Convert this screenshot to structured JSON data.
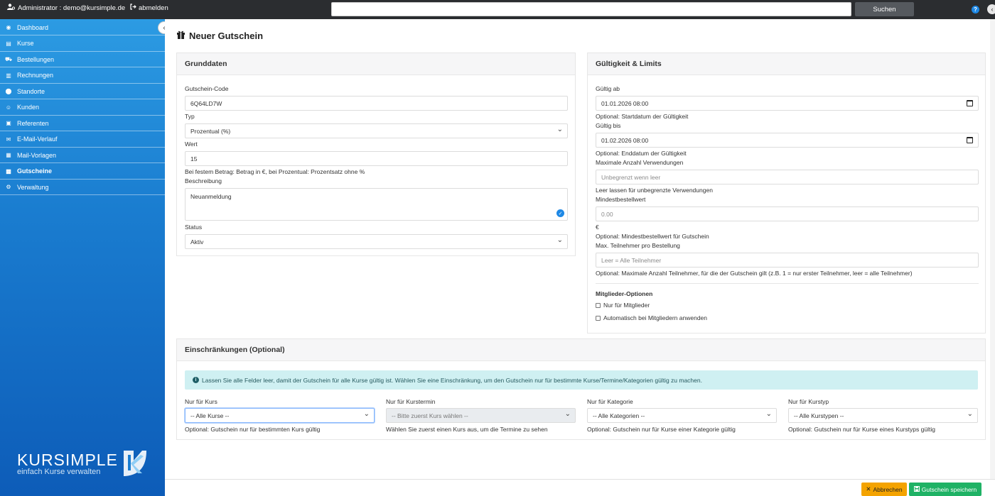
{
  "topbar": {
    "user_label": "Administrator : demo@kursimple.de",
    "logout_label": "abmelden",
    "search_value": "",
    "search_button": "Suchen",
    "help_glyph": "?"
  },
  "sidebar": {
    "items": [
      {
        "label": "Dashboard",
        "icon": "dashboard-icon",
        "glyph": "◉"
      },
      {
        "label": "Kurse",
        "icon": "book-icon",
        "glyph": "▤"
      },
      {
        "label": "Bestellungen",
        "icon": "cart-icon",
        "glyph": "⛟"
      },
      {
        "label": "Rechnungen",
        "icon": "invoice-icon",
        "glyph": "▥"
      },
      {
        "label": "Standorte",
        "icon": "map-marker-icon",
        "glyph": "⬤"
      },
      {
        "label": "Kunden",
        "icon": "users-icon",
        "glyph": "☺"
      },
      {
        "label": "Referenten",
        "icon": "id-card-icon",
        "glyph": "▣"
      },
      {
        "label": "E-Mail-Verlauf",
        "icon": "envelope-icon",
        "glyph": "✉"
      },
      {
        "label": "Mail-Vorlagen",
        "icon": "file-icon",
        "glyph": "▦"
      },
      {
        "label": "Gutscheine",
        "icon": "gift-icon",
        "glyph": "▩"
      },
      {
        "label": "Verwaltung",
        "icon": "gear-icon",
        "glyph": "⚙"
      }
    ],
    "active_index": 9,
    "brand_name": "KURSIMPLE",
    "brand_tagline": "einfach Kurse verwalten"
  },
  "page": {
    "title": "Neuer Gutschein"
  },
  "grunddaten": {
    "title": "Grunddaten",
    "code_label": "Gutschein-Code",
    "code_value": "6Q64LD7W",
    "type_label": "Typ",
    "type_value": "Prozentual (%)",
    "value_label": "Wert",
    "value_value": "15",
    "value_help": "Bei festem Betrag: Betrag in €, bei Prozentual: Prozentsatz ohne %",
    "desc_label": "Beschreibung",
    "desc_value": "Neuanmeldung",
    "status_label": "Status",
    "status_value": "Aktiv"
  },
  "gueltigkeit": {
    "title": "Gültigkeit & Limits",
    "from_label": "Gültig ab",
    "from_value": "01.01.2026 08:00",
    "from_help": "Optional: Startdatum der Gültigkeit",
    "to_label": "Gültig bis",
    "to_value": "01.02.2026 08:00",
    "to_help": "Optional: Enddatum der Gültigkeit",
    "max_uses_label": "Maximale Anzahl Verwendungen",
    "max_uses_placeholder": "Unbegrenzt wenn leer",
    "max_uses_help": "Leer lassen für unbegrenzte Verwendungen",
    "min_order_label": "Mindestbestellwert",
    "min_order_placeholder": "0.00",
    "min_order_unit": "€",
    "min_order_help": "Optional: Mindestbestellwert für Gutschein",
    "max_part_label": "Max. Teilnehmer pro Bestellung",
    "max_part_placeholder": "Leer = Alle Teilnehmer",
    "max_part_help": "Optional: Maximale Anzahl Teilnehmer, für die der Gutschein gilt (z.B. 1 = nur erster Teilnehmer, leer = alle Teilnehmer)",
    "members_title": "Mitglieder-Optionen",
    "members_only": "Nur für Mitglieder",
    "members_auto": "Automatisch bei Mitgliedern anwenden"
  },
  "einschraenkungen": {
    "title": "Einschränkungen (Optional)",
    "info": "Lassen Sie alle Felder leer, damit der Gutschein für alle Kurse gültig ist. Wählen Sie eine Einschränkung, um den Gutschein nur für bestimmte Kurse/Termine/Kategorien gültig zu machen.",
    "course_label": "Nur für Kurs",
    "course_value": "-- Alle Kurse --",
    "course_help": "Optional: Gutschein nur für bestimmten Kurs gültig",
    "date_label": "Nur für Kurstermin",
    "date_value": "-- Bitte zuerst Kurs wählen --",
    "date_help": "Wählen Sie zuerst einen Kurs aus, um die Termine zu sehen",
    "cat_label": "Nur für Kategorie",
    "cat_value": "-- Alle Kategorien --",
    "cat_help": "Optional: Gutschein nur für Kurse einer Kategorie gültig",
    "type_label": "Nur für Kurstyp",
    "type_value": "-- Alle Kurstypen --",
    "type_help": "Optional: Gutschein nur für Kurse eines Kurstyps gültig"
  },
  "actions": {
    "cancel": "Abbrechen",
    "save": "Gutschein speichern"
  },
  "colors": {
    "sidebar_top": "#2c9be3",
    "sidebar_bottom": "#0d5cb8",
    "cancel": "#f4a300",
    "save": "#1fb265",
    "info_bg": "#cff0f2"
  }
}
